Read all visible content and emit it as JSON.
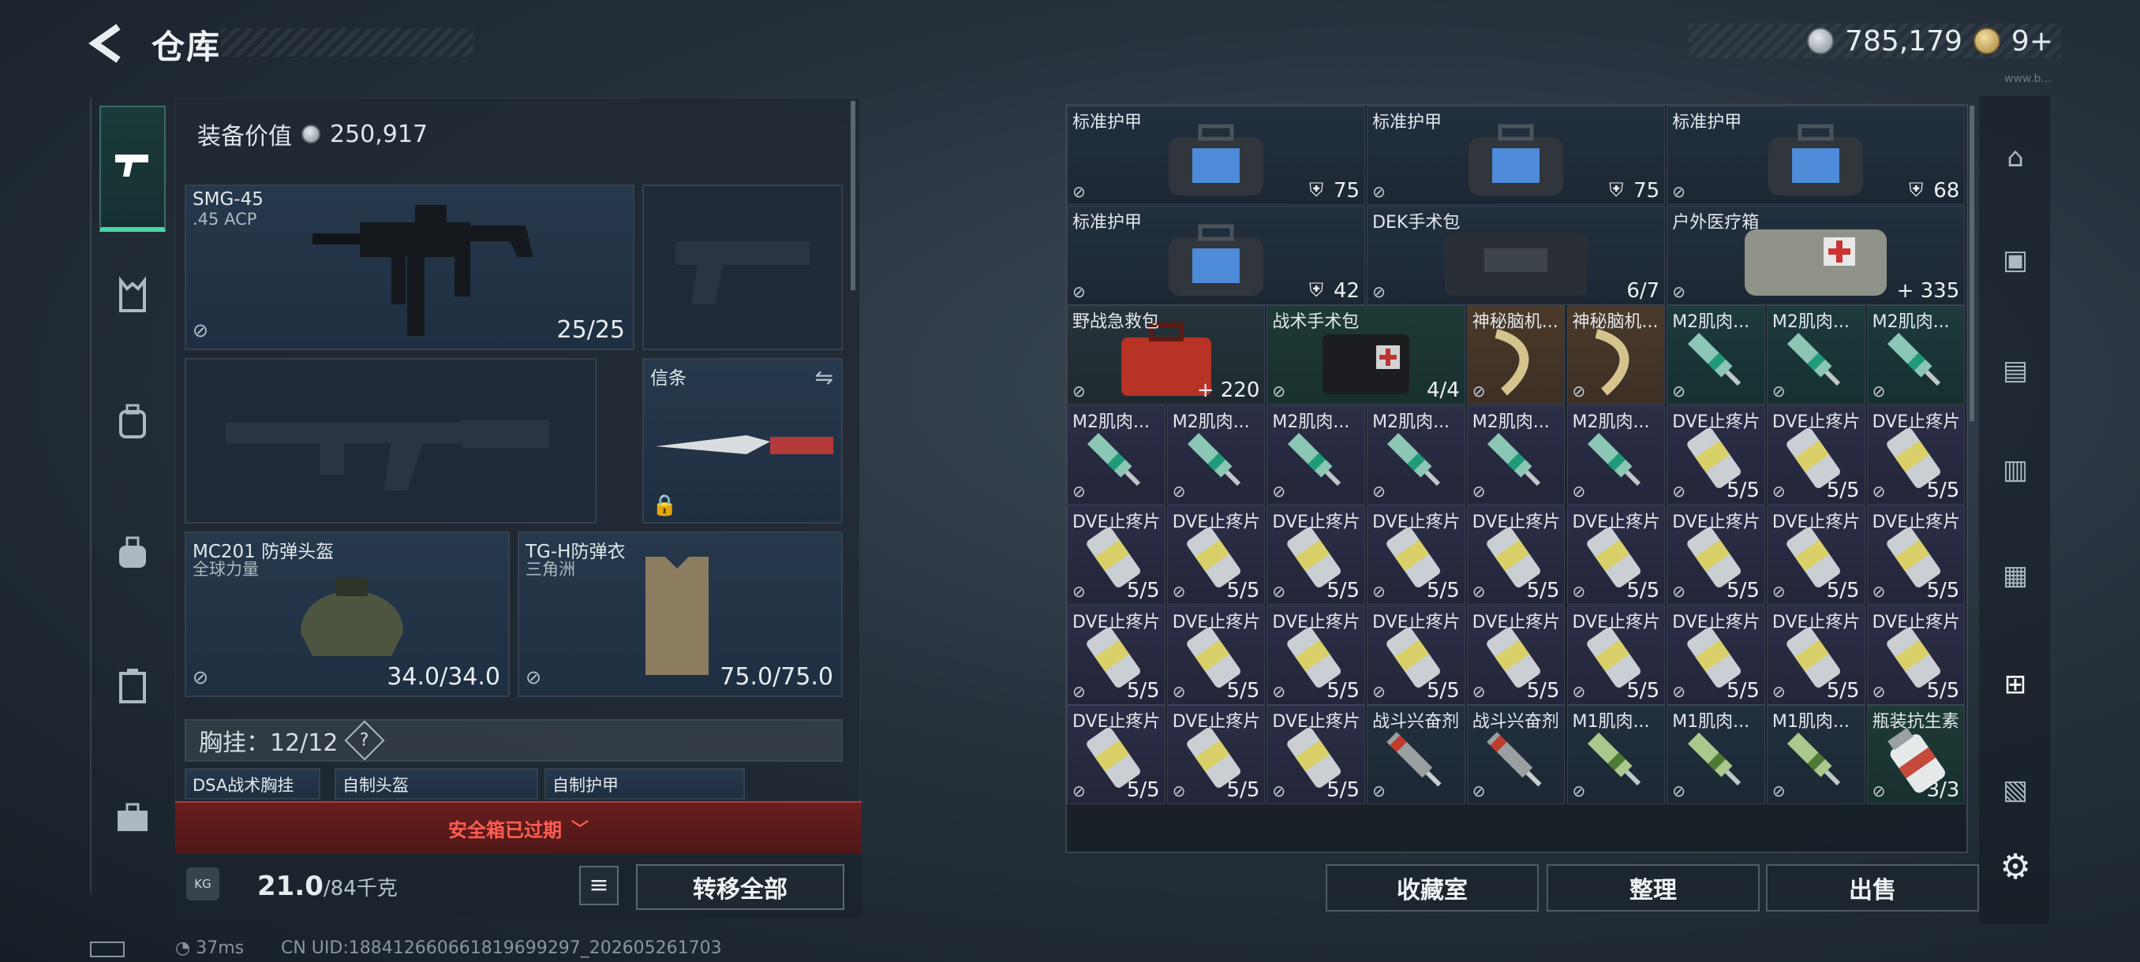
{
  "header": {
    "title": "仓库",
    "currency": "785,179",
    "tickets": "9+",
    "version": "www.b..."
  },
  "loadout": {
    "equipment_value_label": "装备价值",
    "equipment_value": "250,917",
    "primary": {
      "name": "SMG-45",
      "sub": ".45 ACP",
      "count": "25/25"
    },
    "melee": {
      "name": "信条"
    },
    "helmet": {
      "name": "MC201 防弹头盔",
      "sub": "全球力量",
      "count": "34.0/34.0"
    },
    "armor": {
      "name": "TG-H防弹衣",
      "sub": "三角洲",
      "count": "75.0/75.0"
    },
    "chest_label": "胸挂：12/12",
    "chest_help": "?",
    "mini_slots": [
      "DSA战术胸挂",
      "自制头盔",
      "自制护甲"
    ],
    "mini_sub": "三角洲",
    "alert": "安全箱已过期",
    "weight": "21.0",
    "weight_max": "/84千克",
    "transfer_all": "转移全部"
  },
  "stash": {
    "rows": [
      [
        {
          "n": "标准护甲",
          "c": "75",
          "t": "armor",
          "s": "big"
        },
        {
          "n": "标准护甲",
          "c": "75",
          "t": "armor",
          "s": "big"
        },
        {
          "n": "标准护甲",
          "c": "68",
          "t": "armor",
          "s": "big"
        }
      ],
      [
        {
          "n": "标准护甲",
          "c": "42",
          "t": "armor",
          "s": "big"
        },
        {
          "n": "DEK手术包",
          "c": "6/7",
          "t": "kit",
          "s": "big"
        },
        {
          "n": "户外医疗箱",
          "c": "+ 335",
          "t": "medbox",
          "s": "big"
        }
      ],
      [
        {
          "n": "野战急救包",
          "c": "+ 220",
          "t": "firstaid",
          "s": "wide",
          "k": "red"
        },
        {
          "n": "战术手术包",
          "c": "4/4",
          "t": "surg",
          "s": "wide",
          "k": "green"
        },
        {
          "n": "神秘脑机...",
          "c": "",
          "t": "neuro",
          "k": "gold"
        },
        {
          "n": "神秘脑机...",
          "c": "",
          "t": "neuro",
          "k": "gold"
        },
        {
          "n": "M2肌肉...",
          "c": "",
          "t": "inj",
          "k": "teal"
        },
        {
          "n": "M2肌肉...",
          "c": "",
          "t": "inj",
          "k": "teal"
        },
        {
          "n": "M2肌肉...",
          "c": "",
          "t": "inj",
          "k": "teal"
        }
      ],
      [
        {
          "n": "M2肌肉...",
          "c": "",
          "t": "inj",
          "k": "violet"
        },
        {
          "n": "M2肌肉...",
          "c": "",
          "t": "inj",
          "k": "violet"
        },
        {
          "n": "M2肌肉...",
          "c": "",
          "t": "inj",
          "k": "violet"
        },
        {
          "n": "M2肌肉...",
          "c": "",
          "t": "inj",
          "k": "violet"
        },
        {
          "n": "M2肌肉...",
          "c": "",
          "t": "inj",
          "k": "violet"
        },
        {
          "n": "M2肌肉...",
          "c": "",
          "t": "inj",
          "k": "violet"
        },
        {
          "n": "DVE止疼片",
          "c": "5/5",
          "t": "pill",
          "k": "violet"
        },
        {
          "n": "DVE止疼片",
          "c": "5/5",
          "t": "pill",
          "k": "violet"
        },
        {
          "n": "DVE止疼片",
          "c": "5/5",
          "t": "pill",
          "k": "violet"
        }
      ],
      [
        {
          "n": "DVE止疼片",
          "c": "5/5",
          "t": "pill",
          "k": "violet"
        },
        {
          "n": "DVE止疼片",
          "c": "5/5",
          "t": "pill",
          "k": "violet"
        },
        {
          "n": "DVE止疼片",
          "c": "5/5",
          "t": "pill",
          "k": "violet"
        },
        {
          "n": "DVE止疼片",
          "c": "5/5",
          "t": "pill",
          "k": "violet"
        },
        {
          "n": "DVE止疼片",
          "c": "5/5",
          "t": "pill",
          "k": "violet"
        },
        {
          "n": "DVE止疼片",
          "c": "5/5",
          "t": "pill",
          "k": "violet"
        },
        {
          "n": "DVE止疼片",
          "c": "5/5",
          "t": "pill",
          "k": "violet"
        },
        {
          "n": "DVE止疼片",
          "c": "5/5",
          "t": "pill",
          "k": "violet"
        },
        {
          "n": "DVE止疼片",
          "c": "5/5",
          "t": "pill",
          "k": "violet"
        }
      ],
      [
        {
          "n": "DVE止疼片",
          "c": "5/5",
          "t": "pill",
          "k": "violet"
        },
        {
          "n": "DVE止疼片",
          "c": "5/5",
          "t": "pill",
          "k": "violet"
        },
        {
          "n": "DVE止疼片",
          "c": "5/5",
          "t": "pill",
          "k": "violet"
        },
        {
          "n": "DVE止疼片",
          "c": "5/5",
          "t": "pill",
          "k": "violet"
        },
        {
          "n": "DVE止疼片",
          "c": "5/5",
          "t": "pill",
          "k": "violet"
        },
        {
          "n": "DVE止疼片",
          "c": "5/5",
          "t": "pill",
          "k": "violet"
        },
        {
          "n": "DVE止疼片",
          "c": "5/5",
          "t": "pill",
          "k": "violet"
        },
        {
          "n": "DVE止疼片",
          "c": "5/5",
          "t": "pill",
          "k": "violet"
        },
        {
          "n": "DVE止疼片",
          "c": "5/5",
          "t": "pill",
          "k": "violet"
        }
      ],
      [
        {
          "n": "DVE止疼片",
          "c": "5/5",
          "t": "pill",
          "k": "violet"
        },
        {
          "n": "DVE止疼片",
          "c": "5/5",
          "t": "pill",
          "k": "violet"
        },
        {
          "n": "DVE止疼片",
          "c": "5/5",
          "t": "pill",
          "k": "violet"
        },
        {
          "n": "战斗兴奋剂",
          "c": "",
          "t": "stim",
          "k": "blue"
        },
        {
          "n": "战斗兴奋剂",
          "c": "",
          "t": "stim",
          "k": "blue"
        },
        {
          "n": "M1肌肉...",
          "c": "",
          "t": "inj1",
          "k": "blue"
        },
        {
          "n": "M1肌肉...",
          "c": "",
          "t": "inj1",
          "k": "blue"
        },
        {
          "n": "M1肌肉...",
          "c": "",
          "t": "inj1",
          "k": "blue"
        },
        {
          "n": "瓶装抗生素",
          "c": "3/3",
          "t": "bottle",
          "k": "green"
        }
      ]
    ]
  },
  "buttons": {
    "collection": "收藏室",
    "organize": "整理",
    "sell": "出售"
  },
  "status": {
    "ping": "37ms",
    "uid": "CN UID:18841266066181969929​7_202605261703"
  }
}
